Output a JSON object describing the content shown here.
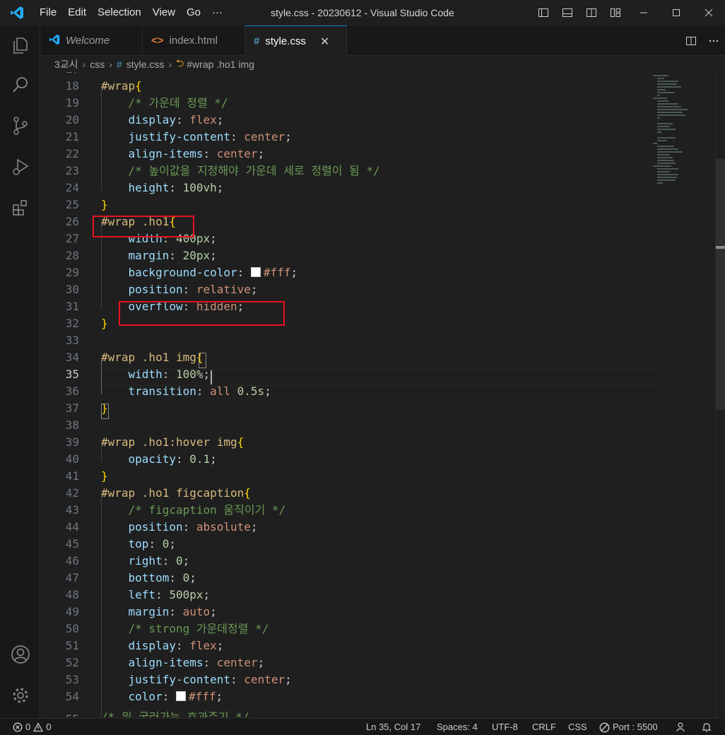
{
  "titlebar": {
    "menu": [
      "File",
      "Edit",
      "Selection",
      "View",
      "Go"
    ],
    "more": "···",
    "title": "style.css - 20230612 - Visual Studio Code"
  },
  "tabs": [
    {
      "label": "Welcome",
      "icon": "vscode-icon"
    },
    {
      "label": "index.html",
      "icon": "html-icon"
    },
    {
      "label": "style.css",
      "icon": "css-icon",
      "active": true,
      "close": "✕"
    }
  ],
  "breadcrumb": [
    "3교시",
    "css",
    "style.css",
    "#wrap .ho1 img"
  ],
  "editor": {
    "partial_top_line": "17",
    "partial_bottom_line": "55",
    "partial_bottom_text": "/* 위 굴러가는 효과주기 */",
    "lines": [
      {
        "n": "18",
        "seg": [
          {
            "t": "#wrap",
            "c": "sel"
          },
          {
            "t": "{",
            "c": "brace"
          }
        ]
      },
      {
        "n": "19",
        "seg": [
          {
            "t": "    /* 가운데 정렬 */",
            "c": "com"
          }
        ]
      },
      {
        "n": "20",
        "seg": [
          {
            "t": "    "
          },
          {
            "t": "display",
            "c": "prop"
          },
          {
            "t": ": "
          },
          {
            "t": "flex",
            "c": "val"
          },
          {
            "t": ";"
          }
        ]
      },
      {
        "n": "21",
        "seg": [
          {
            "t": "    "
          },
          {
            "t": "justify-content",
            "c": "prop"
          },
          {
            "t": ": "
          },
          {
            "t": "center",
            "c": "val"
          },
          {
            "t": ";"
          }
        ]
      },
      {
        "n": "22",
        "seg": [
          {
            "t": "    "
          },
          {
            "t": "align-items",
            "c": "prop"
          },
          {
            "t": ": "
          },
          {
            "t": "center",
            "c": "val"
          },
          {
            "t": ";"
          }
        ]
      },
      {
        "n": "23",
        "seg": [
          {
            "t": "    /* 높이값을 지정해야 가운데 세로 정렬이 됨 */",
            "c": "com"
          }
        ]
      },
      {
        "n": "24",
        "seg": [
          {
            "t": "    "
          },
          {
            "t": "height",
            "c": "prop"
          },
          {
            "t": ": "
          },
          {
            "t": "100vh",
            "c": "num"
          },
          {
            "t": ";"
          }
        ]
      },
      {
        "n": "25",
        "seg": [
          {
            "t": "}",
            "c": "brace"
          }
        ]
      },
      {
        "n": "26",
        "seg": [
          {
            "t": "#wrap .ho1",
            "c": "sel"
          },
          {
            "t": "{",
            "c": "brace"
          }
        ]
      },
      {
        "n": "27",
        "seg": [
          {
            "t": "    "
          },
          {
            "t": "width",
            "c": "prop"
          },
          {
            "t": ": "
          },
          {
            "t": "400px",
            "c": "num"
          },
          {
            "t": ";"
          }
        ]
      },
      {
        "n": "28",
        "seg": [
          {
            "t": "    "
          },
          {
            "t": "margin",
            "c": "prop"
          },
          {
            "t": ": "
          },
          {
            "t": "20px",
            "c": "num"
          },
          {
            "t": ";"
          }
        ]
      },
      {
        "n": "29",
        "seg": [
          {
            "t": "    "
          },
          {
            "t": "background-color",
            "c": "prop"
          },
          {
            "t": ": "
          },
          {
            "t": "",
            "c": "swatch"
          },
          {
            "t": "#fff",
            "c": "val"
          },
          {
            "t": ";"
          }
        ]
      },
      {
        "n": "30",
        "seg": [
          {
            "t": "    "
          },
          {
            "t": "position",
            "c": "prop"
          },
          {
            "t": ": "
          },
          {
            "t": "relative",
            "c": "val"
          },
          {
            "t": ";"
          }
        ]
      },
      {
        "n": "31",
        "seg": [
          {
            "t": "    "
          },
          {
            "t": "overflow",
            "c": "prop"
          },
          {
            "t": ": "
          },
          {
            "t": "hidden",
            "c": "val"
          },
          {
            "t": ";"
          }
        ]
      },
      {
        "n": "32",
        "seg": [
          {
            "t": "}",
            "c": "brace"
          }
        ]
      },
      {
        "n": "33",
        "seg": []
      },
      {
        "n": "34",
        "seg": [
          {
            "t": "#wrap .ho1 img",
            "c": "sel"
          },
          {
            "t": "{",
            "c": "brace"
          }
        ]
      },
      {
        "n": "35",
        "seg": [
          {
            "t": "    "
          },
          {
            "t": "width",
            "c": "prop"
          },
          {
            "t": ": "
          },
          {
            "t": "100%",
            "c": "num"
          },
          {
            "t": ";"
          }
        ]
      },
      {
        "n": "36",
        "seg": [
          {
            "t": "    "
          },
          {
            "t": "transition",
            "c": "prop"
          },
          {
            "t": ": "
          },
          {
            "t": "all ",
            "c": "val"
          },
          {
            "t": "0.5s",
            "c": "num"
          },
          {
            "t": ";"
          }
        ]
      },
      {
        "n": "37",
        "seg": [
          {
            "t": "}",
            "c": "brace"
          }
        ]
      },
      {
        "n": "38",
        "seg": []
      },
      {
        "n": "39",
        "seg": [
          {
            "t": "#wrap .ho1:hover img",
            "c": "sel"
          },
          {
            "t": "{",
            "c": "brace"
          }
        ]
      },
      {
        "n": "40",
        "seg": [
          {
            "t": "    "
          },
          {
            "t": "opacity",
            "c": "prop"
          },
          {
            "t": ": "
          },
          {
            "t": "0.1",
            "c": "num"
          },
          {
            "t": ";"
          }
        ]
      },
      {
        "n": "41",
        "seg": [
          {
            "t": "}",
            "c": "brace"
          }
        ]
      },
      {
        "n": "42",
        "seg": [
          {
            "t": "#wrap .ho1 figcaption",
            "c": "sel"
          },
          {
            "t": "{",
            "c": "brace"
          }
        ]
      },
      {
        "n": "43",
        "seg": [
          {
            "t": "    /* figcaption 움직이기 */",
            "c": "com"
          }
        ]
      },
      {
        "n": "44",
        "seg": [
          {
            "t": "    "
          },
          {
            "t": "position",
            "c": "prop"
          },
          {
            "t": ": "
          },
          {
            "t": "absolute",
            "c": "val"
          },
          {
            "t": ";"
          }
        ]
      },
      {
        "n": "45",
        "seg": [
          {
            "t": "    "
          },
          {
            "t": "top",
            "c": "prop"
          },
          {
            "t": ": "
          },
          {
            "t": "0",
            "c": "num"
          },
          {
            "t": ";"
          }
        ]
      },
      {
        "n": "46",
        "seg": [
          {
            "t": "    "
          },
          {
            "t": "right",
            "c": "prop"
          },
          {
            "t": ": "
          },
          {
            "t": "0",
            "c": "num"
          },
          {
            "t": ";"
          }
        ]
      },
      {
        "n": "47",
        "seg": [
          {
            "t": "    "
          },
          {
            "t": "bottom",
            "c": "prop"
          },
          {
            "t": ": "
          },
          {
            "t": "0",
            "c": "num"
          },
          {
            "t": ";"
          }
        ]
      },
      {
        "n": "48",
        "seg": [
          {
            "t": "    "
          },
          {
            "t": "left",
            "c": "prop"
          },
          {
            "t": ": "
          },
          {
            "t": "500px",
            "c": "num"
          },
          {
            "t": ";"
          }
        ]
      },
      {
        "n": "49",
        "seg": [
          {
            "t": "    "
          },
          {
            "t": "margin",
            "c": "prop"
          },
          {
            "t": ": "
          },
          {
            "t": "auto",
            "c": "val"
          },
          {
            "t": ";"
          }
        ]
      },
      {
        "n": "50",
        "seg": [
          {
            "t": "    /* strong 가운데정렬 */",
            "c": "com"
          }
        ]
      },
      {
        "n": "51",
        "seg": [
          {
            "t": "    "
          },
          {
            "t": "display",
            "c": "prop"
          },
          {
            "t": ": "
          },
          {
            "t": "flex",
            "c": "val"
          },
          {
            "t": ";"
          }
        ]
      },
      {
        "n": "52",
        "seg": [
          {
            "t": "    "
          },
          {
            "t": "align-items",
            "c": "prop"
          },
          {
            "t": ": "
          },
          {
            "t": "center",
            "c": "val"
          },
          {
            "t": ";"
          }
        ]
      },
      {
        "n": "53",
        "seg": [
          {
            "t": "    "
          },
          {
            "t": "justify-content",
            "c": "prop"
          },
          {
            "t": ": "
          },
          {
            "t": "center",
            "c": "val"
          },
          {
            "t": ";"
          }
        ]
      },
      {
        "n": "54",
        "seg": [
          {
            "t": "    "
          },
          {
            "t": "color",
            "c": "prop"
          },
          {
            "t": ": "
          },
          {
            "t": "",
            "c": "swatch"
          },
          {
            "t": "#fff",
            "c": "val"
          },
          {
            "t": ";"
          }
        ]
      }
    ]
  },
  "statusbar": {
    "errors": "0",
    "warnings": "0",
    "position": "Ln 35, Col 17",
    "spaces": "Spaces: 4",
    "encoding": "UTF-8",
    "eol": "CRLF",
    "language": "CSS",
    "port": "Port : 5500"
  },
  "colors": {
    "accent": "#0078d4",
    "annotation_box": "#e81123"
  }
}
